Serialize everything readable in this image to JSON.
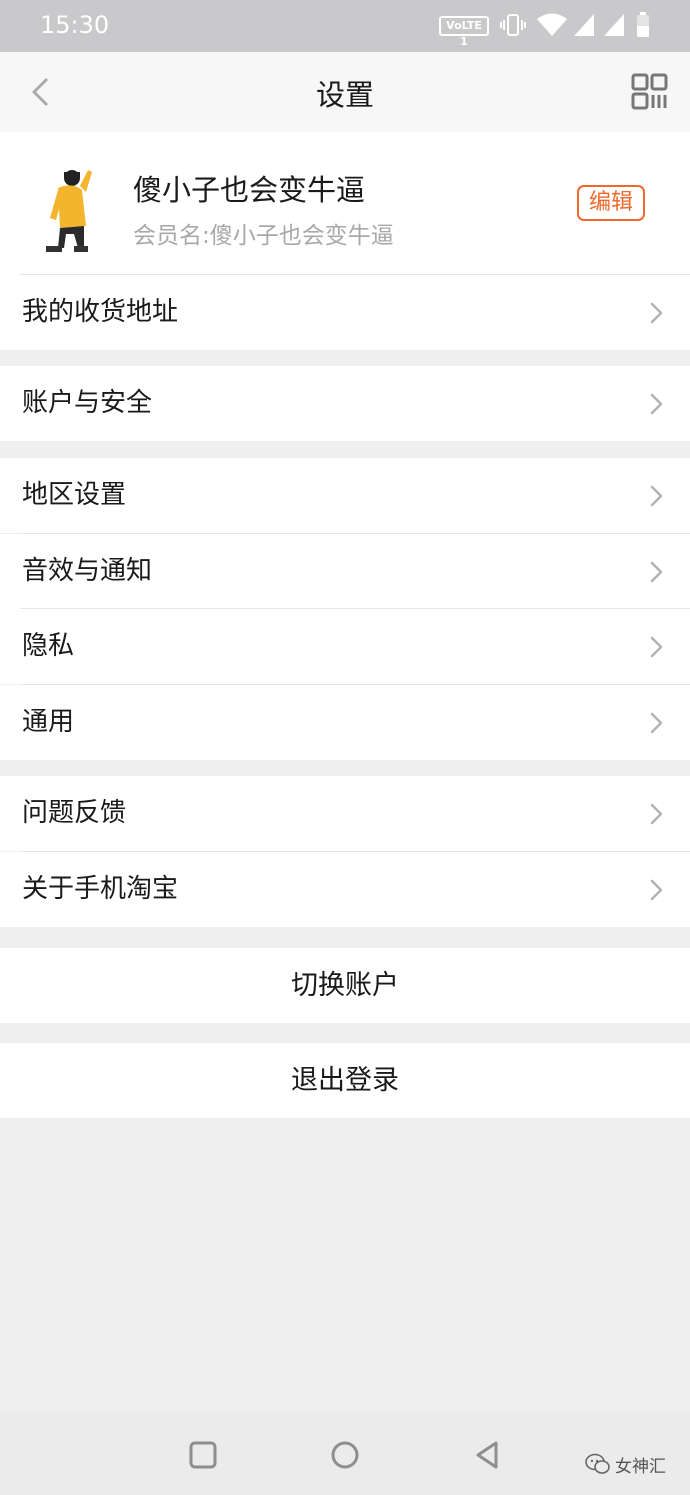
{
  "status_bar": {
    "time": "15:30",
    "volte": "VoLTE 1"
  },
  "nav": {
    "title": "设置"
  },
  "profile": {
    "name": "傻小子也会变牛逼",
    "member_label": "会员名:傻小子也会变牛逼",
    "edit_label": "编辑"
  },
  "groups": {
    "address": "我的收货地址",
    "account_security": "账户与安全",
    "region": "地区设置",
    "sound": "音效与通知",
    "privacy": "隐私",
    "general": "通用",
    "feedback": "问题反馈",
    "about": "关于手机淘宝"
  },
  "actions": {
    "switch_account": "切换账户",
    "logout": "退出登录"
  },
  "watermark": {
    "text": "女神汇"
  },
  "colors": {
    "accent": "#ef6a2a",
    "background": "#efeff0",
    "status_bar": "#c9c9cb"
  }
}
